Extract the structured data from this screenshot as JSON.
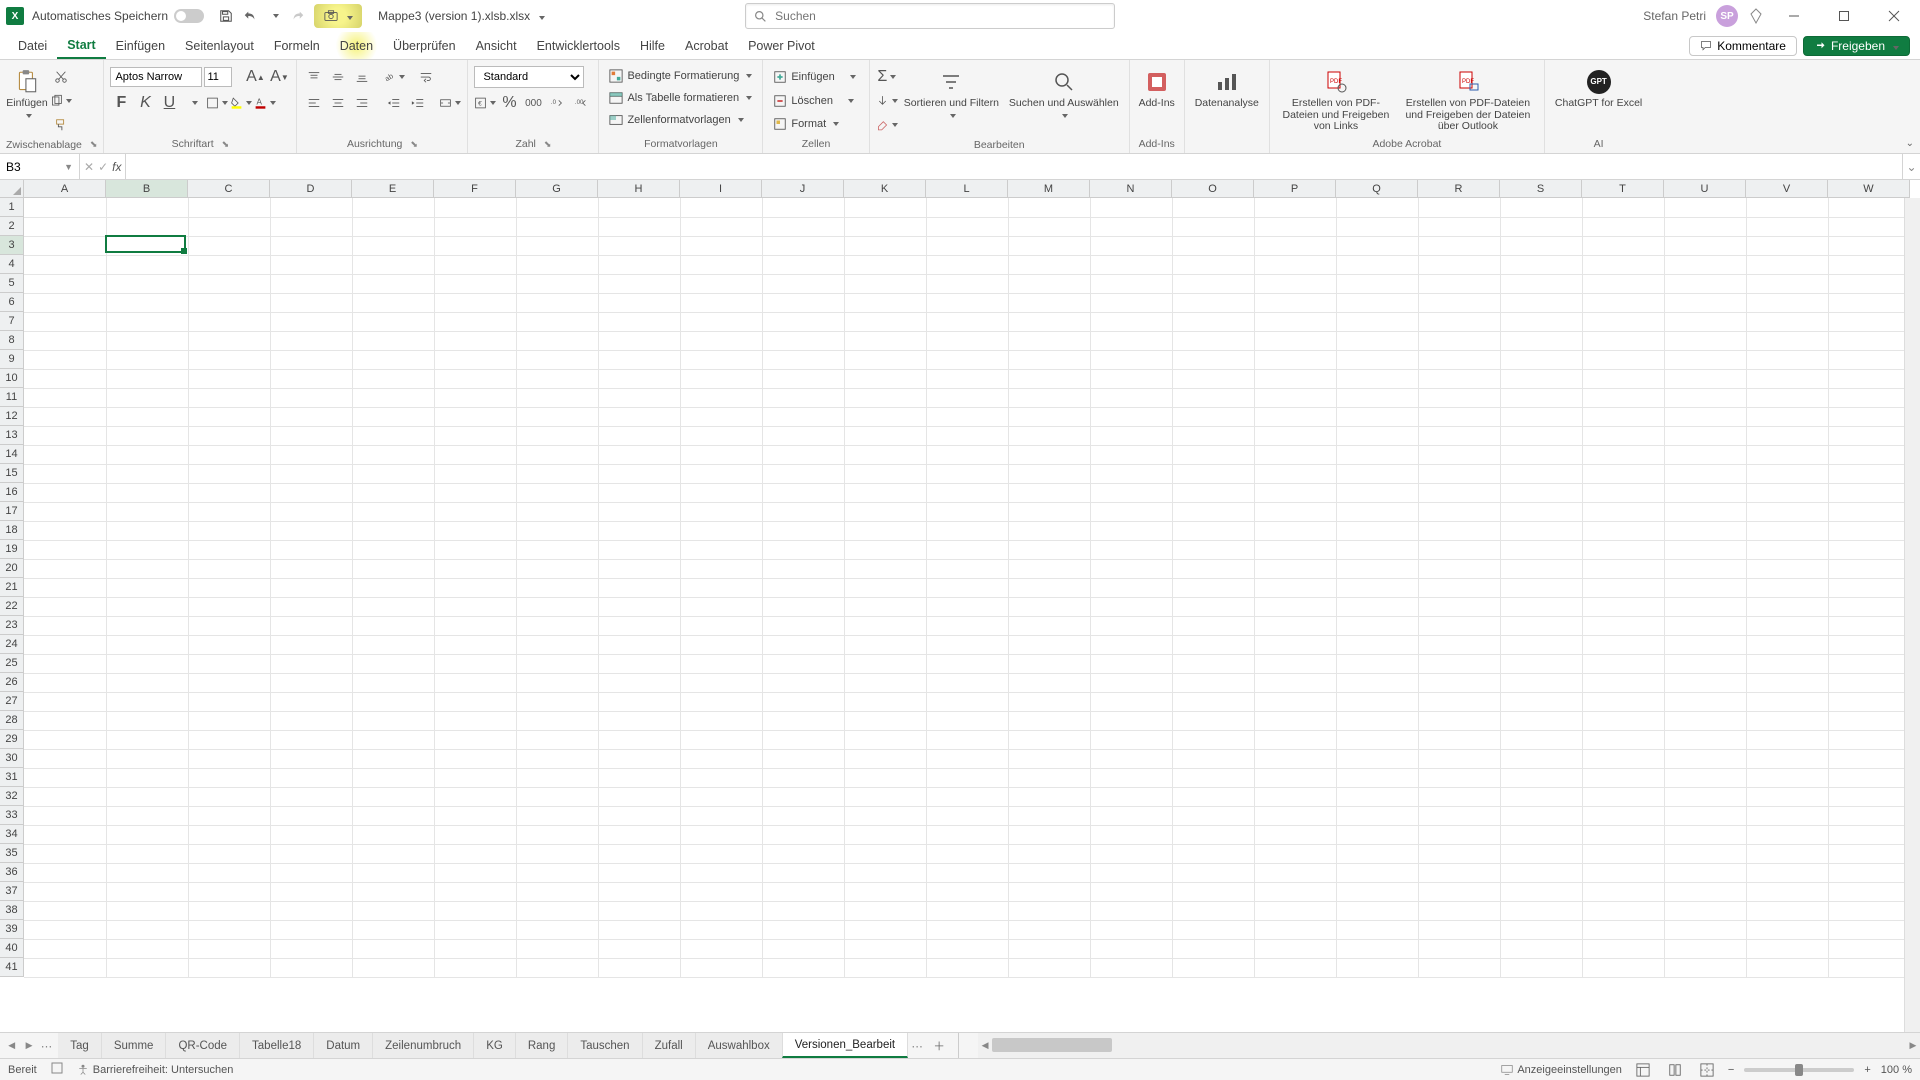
{
  "titlebar": {
    "autosave_label": "Automatisches Speichern",
    "filename": "Mappe3 (version 1).xlsb.xlsx",
    "search_placeholder": "Suchen",
    "user_name": "Stefan Petri"
  },
  "tabs": {
    "items": [
      "Datei",
      "Start",
      "Einfügen",
      "Seitenlayout",
      "Formeln",
      "Daten",
      "Überprüfen",
      "Ansicht",
      "Entwicklertools",
      "Hilfe",
      "Acrobat",
      "Power Pivot"
    ],
    "active_index": 1,
    "highlight_index": 5,
    "kommentare": "Kommentare",
    "freigeben": "Freigeben"
  },
  "ribbon": {
    "clipboard": {
      "paste": "Einfügen",
      "label": "Zwischenablage"
    },
    "font": {
      "name": "Aptos Narrow",
      "size": "11",
      "label": "Schriftart",
      "fill_color": "#ffff00",
      "font_color": "#c00000"
    },
    "alignment": {
      "label": "Ausrichtung"
    },
    "number": {
      "format": "Standard",
      "label": "Zahl"
    },
    "styles": {
      "cond": "Bedingte Formatierung",
      "table": "Als Tabelle formatieren",
      "cell": "Zellenformatvorlagen",
      "label": "Formatvorlagen"
    },
    "cells": {
      "insert": "Einfügen",
      "delete": "Löschen",
      "format": "Format",
      "label": "Zellen"
    },
    "editing": {
      "sort": "Sortieren und Filtern",
      "find": "Suchen und Auswählen",
      "label": "Bearbeiten"
    },
    "addins": {
      "btn": "Add-Ins",
      "label": "Add-Ins"
    },
    "analysis": {
      "btn": "Datenanalyse"
    },
    "acrobat": {
      "pdf1": "Erstellen von PDF-Dateien und Freigeben von Links",
      "pdf2": "Erstellen von PDF-Dateien und Freigeben der Dateien über Outlook",
      "label": "Adobe Acrobat"
    },
    "ai": {
      "btn": "ChatGPT for Excel",
      "label": "AI"
    }
  },
  "formula_bar": {
    "cell_ref": "B3",
    "formula": ""
  },
  "grid": {
    "columns": [
      "A",
      "B",
      "C",
      "D",
      "E",
      "F",
      "G",
      "H",
      "I",
      "J",
      "K",
      "L",
      "M",
      "N",
      "O",
      "P",
      "Q",
      "R",
      "S",
      "T",
      "U",
      "V",
      "W"
    ],
    "row_count": 41,
    "selected_col_index": 1,
    "selected_row_index": 2
  },
  "sheets": {
    "tabs": [
      "Tag",
      "Summe",
      "QR-Code",
      "Tabelle18",
      "Datum",
      "Zeilenumbruch",
      "KG",
      "Rang",
      "Tauschen",
      "Zufall",
      "Auswahlbox",
      "Versionen_Bearbeit"
    ],
    "active_index": 11
  },
  "status": {
    "ready": "Bereit",
    "accessibility": "Barrierefreiheit: Untersuchen",
    "display_settings": "Anzeigeeinstellungen",
    "zoom": "100 %"
  },
  "colors": {
    "accent": "#107c41"
  }
}
